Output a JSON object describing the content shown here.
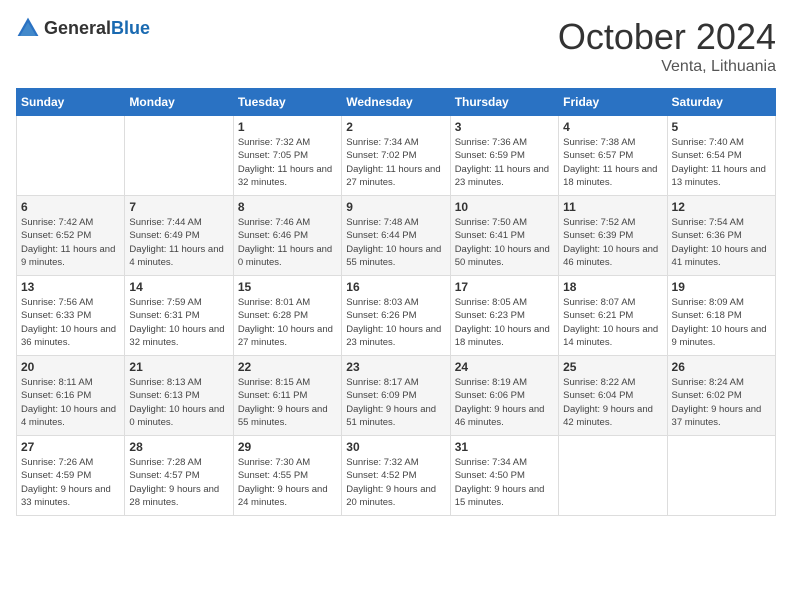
{
  "header": {
    "logo_general": "General",
    "logo_blue": "Blue",
    "month_year": "October 2024",
    "location": "Venta, Lithuania"
  },
  "columns": [
    "Sunday",
    "Monday",
    "Tuesday",
    "Wednesday",
    "Thursday",
    "Friday",
    "Saturday"
  ],
  "weeks": [
    [
      {
        "day": "",
        "info": ""
      },
      {
        "day": "",
        "info": ""
      },
      {
        "day": "1",
        "info": "Sunrise: 7:32 AM\nSunset: 7:05 PM\nDaylight: 11 hours and 32 minutes."
      },
      {
        "day": "2",
        "info": "Sunrise: 7:34 AM\nSunset: 7:02 PM\nDaylight: 11 hours and 27 minutes."
      },
      {
        "day": "3",
        "info": "Sunrise: 7:36 AM\nSunset: 6:59 PM\nDaylight: 11 hours and 23 minutes."
      },
      {
        "day": "4",
        "info": "Sunrise: 7:38 AM\nSunset: 6:57 PM\nDaylight: 11 hours and 18 minutes."
      },
      {
        "day": "5",
        "info": "Sunrise: 7:40 AM\nSunset: 6:54 PM\nDaylight: 11 hours and 13 minutes."
      }
    ],
    [
      {
        "day": "6",
        "info": "Sunrise: 7:42 AM\nSunset: 6:52 PM\nDaylight: 11 hours and 9 minutes."
      },
      {
        "day": "7",
        "info": "Sunrise: 7:44 AM\nSunset: 6:49 PM\nDaylight: 11 hours and 4 minutes."
      },
      {
        "day": "8",
        "info": "Sunrise: 7:46 AM\nSunset: 6:46 PM\nDaylight: 11 hours and 0 minutes."
      },
      {
        "day": "9",
        "info": "Sunrise: 7:48 AM\nSunset: 6:44 PM\nDaylight: 10 hours and 55 minutes."
      },
      {
        "day": "10",
        "info": "Sunrise: 7:50 AM\nSunset: 6:41 PM\nDaylight: 10 hours and 50 minutes."
      },
      {
        "day": "11",
        "info": "Sunrise: 7:52 AM\nSunset: 6:39 PM\nDaylight: 10 hours and 46 minutes."
      },
      {
        "day": "12",
        "info": "Sunrise: 7:54 AM\nSunset: 6:36 PM\nDaylight: 10 hours and 41 minutes."
      }
    ],
    [
      {
        "day": "13",
        "info": "Sunrise: 7:56 AM\nSunset: 6:33 PM\nDaylight: 10 hours and 36 minutes."
      },
      {
        "day": "14",
        "info": "Sunrise: 7:59 AM\nSunset: 6:31 PM\nDaylight: 10 hours and 32 minutes."
      },
      {
        "day": "15",
        "info": "Sunrise: 8:01 AM\nSunset: 6:28 PM\nDaylight: 10 hours and 27 minutes."
      },
      {
        "day": "16",
        "info": "Sunrise: 8:03 AM\nSunset: 6:26 PM\nDaylight: 10 hours and 23 minutes."
      },
      {
        "day": "17",
        "info": "Sunrise: 8:05 AM\nSunset: 6:23 PM\nDaylight: 10 hours and 18 minutes."
      },
      {
        "day": "18",
        "info": "Sunrise: 8:07 AM\nSunset: 6:21 PM\nDaylight: 10 hours and 14 minutes."
      },
      {
        "day": "19",
        "info": "Sunrise: 8:09 AM\nSunset: 6:18 PM\nDaylight: 10 hours and 9 minutes."
      }
    ],
    [
      {
        "day": "20",
        "info": "Sunrise: 8:11 AM\nSunset: 6:16 PM\nDaylight: 10 hours and 4 minutes."
      },
      {
        "day": "21",
        "info": "Sunrise: 8:13 AM\nSunset: 6:13 PM\nDaylight: 10 hours and 0 minutes."
      },
      {
        "day": "22",
        "info": "Sunrise: 8:15 AM\nSunset: 6:11 PM\nDaylight: 9 hours and 55 minutes."
      },
      {
        "day": "23",
        "info": "Sunrise: 8:17 AM\nSunset: 6:09 PM\nDaylight: 9 hours and 51 minutes."
      },
      {
        "day": "24",
        "info": "Sunrise: 8:19 AM\nSunset: 6:06 PM\nDaylight: 9 hours and 46 minutes."
      },
      {
        "day": "25",
        "info": "Sunrise: 8:22 AM\nSunset: 6:04 PM\nDaylight: 9 hours and 42 minutes."
      },
      {
        "day": "26",
        "info": "Sunrise: 8:24 AM\nSunset: 6:02 PM\nDaylight: 9 hours and 37 minutes."
      }
    ],
    [
      {
        "day": "27",
        "info": "Sunrise: 7:26 AM\nSunset: 4:59 PM\nDaylight: 9 hours and 33 minutes."
      },
      {
        "day": "28",
        "info": "Sunrise: 7:28 AM\nSunset: 4:57 PM\nDaylight: 9 hours and 28 minutes."
      },
      {
        "day": "29",
        "info": "Sunrise: 7:30 AM\nSunset: 4:55 PM\nDaylight: 9 hours and 24 minutes."
      },
      {
        "day": "30",
        "info": "Sunrise: 7:32 AM\nSunset: 4:52 PM\nDaylight: 9 hours and 20 minutes."
      },
      {
        "day": "31",
        "info": "Sunrise: 7:34 AM\nSunset: 4:50 PM\nDaylight: 9 hours and 15 minutes."
      },
      {
        "day": "",
        "info": ""
      },
      {
        "day": "",
        "info": ""
      }
    ]
  ]
}
